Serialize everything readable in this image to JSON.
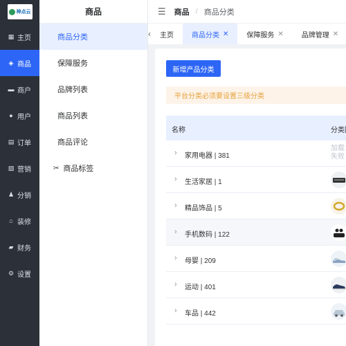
{
  "brand": {
    "logo_text": "神点云"
  },
  "nav": {
    "items": [
      {
        "label": "主页",
        "icon": "grid-icon",
        "glyph": "▦"
      },
      {
        "label": "商品",
        "icon": "bag-icon",
        "glyph": "◈"
      },
      {
        "label": "商户",
        "icon": "store-icon",
        "glyph": "▬"
      },
      {
        "label": "用户",
        "icon": "user-icon",
        "glyph": "●"
      },
      {
        "label": "订单",
        "icon": "order-icon",
        "glyph": "▤"
      },
      {
        "label": "营销",
        "icon": "chart-icon",
        "glyph": "▨"
      },
      {
        "label": "分销",
        "icon": "person-icon",
        "glyph": "♟"
      },
      {
        "label": "装修",
        "icon": "home-icon",
        "glyph": "⌂"
      },
      {
        "label": "财务",
        "icon": "wallet-icon",
        "glyph": "▰"
      },
      {
        "label": "设置",
        "icon": "gear-icon",
        "glyph": "⚙"
      }
    ],
    "active_index": 1
  },
  "submenu": {
    "title": "商品",
    "items": [
      {
        "label": "商品分类"
      },
      {
        "label": "保障服务"
      },
      {
        "label": "品牌列表"
      },
      {
        "label": "商品列表"
      },
      {
        "label": "商品评论"
      },
      {
        "label": "商品标签"
      }
    ],
    "active_index": 0
  },
  "header": {
    "crumb1": "商品",
    "separator": "/",
    "crumb2": "商品分类"
  },
  "tabs": [
    {
      "label": "主页"
    },
    {
      "label": "商品分类"
    },
    {
      "label": "保障服务"
    },
    {
      "label": "品牌管理"
    }
  ],
  "content": {
    "add_button": "新增产品分类",
    "alert": "平台分类必须要设置三级分类",
    "columns": {
      "name": "名称",
      "image": "分类图"
    },
    "load_fail": "加载失败",
    "rows": [
      {
        "name": "家用电器 | 381",
        "thumb": "fail"
      },
      {
        "name": "生活家居 | 1",
        "thumb": "box-image"
      },
      {
        "name": "精品饰品 | 5",
        "thumb": "ring-image"
      },
      {
        "name": "手机数码 | 122",
        "thumb": "earbuds-image"
      },
      {
        "name": "母婴 | 209",
        "thumb": "shoes-image"
      },
      {
        "name": "运动 | 401",
        "thumb": "sneaker-image"
      },
      {
        "name": "车品 | 442",
        "thumb": "car-image"
      }
    ]
  },
  "colors": {
    "primary": "#2d66f6",
    "nav_bg": "#2c3038",
    "alert_bg": "#fdf3e8",
    "alert_text": "#e6a23c"
  }
}
